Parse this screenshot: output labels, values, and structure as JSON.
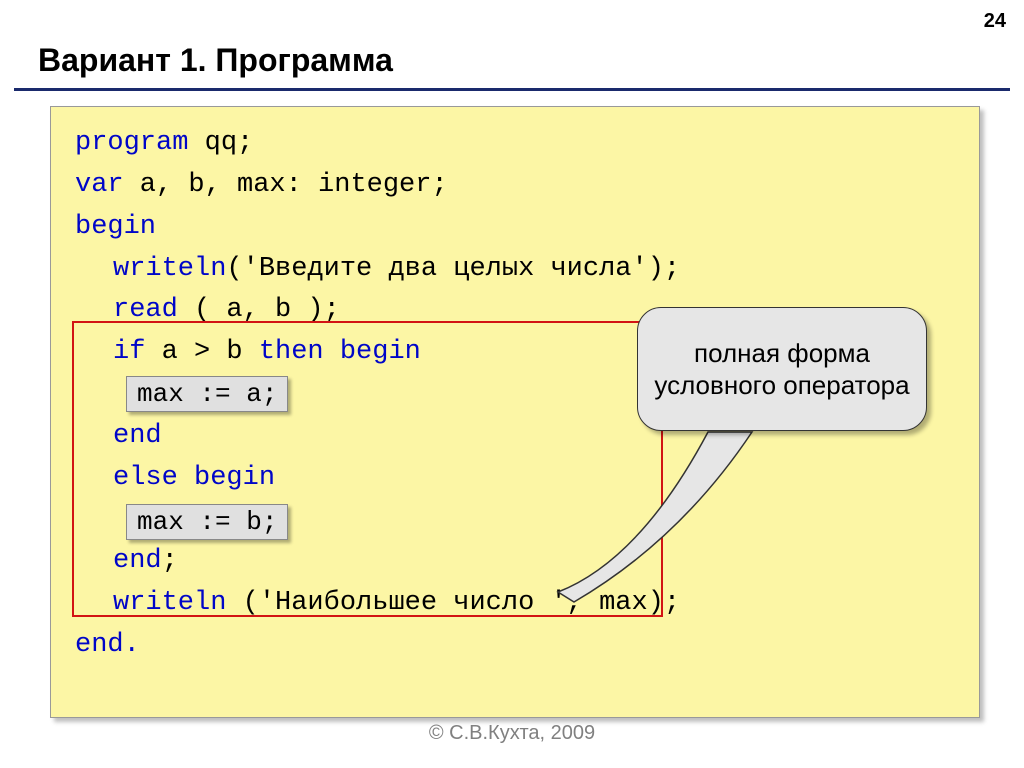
{
  "page_number": "24",
  "title": "Вариант 1. Программа",
  "code": {
    "l1_kw": "program",
    "l1_rest": " qq;",
    "l2_kw": "var",
    "l2_rest": " a, b, max: integer;",
    "l3": "begin",
    "l4_a": "writeln",
    "l4_b": "('Введите два целых числа');",
    "l5_a": "read",
    "l5_b": " ( a, b );",
    "l6_a": "if",
    "l6_b": " a > b ",
    "l6_c": "then begin",
    "l8": "end",
    "l9_a": "else ",
    "l9_b": "begin",
    "l11": "end",
    "l11_b": ";",
    "l12_a": "writeln",
    "l12_b": " ('Наибольшее число ', max);",
    "l13": "end."
  },
  "chips": {
    "a": "max := a;",
    "b": "max := b;"
  },
  "callout": "полная форма условного оператора",
  "footer": "© С.В.Кухта, 2009"
}
